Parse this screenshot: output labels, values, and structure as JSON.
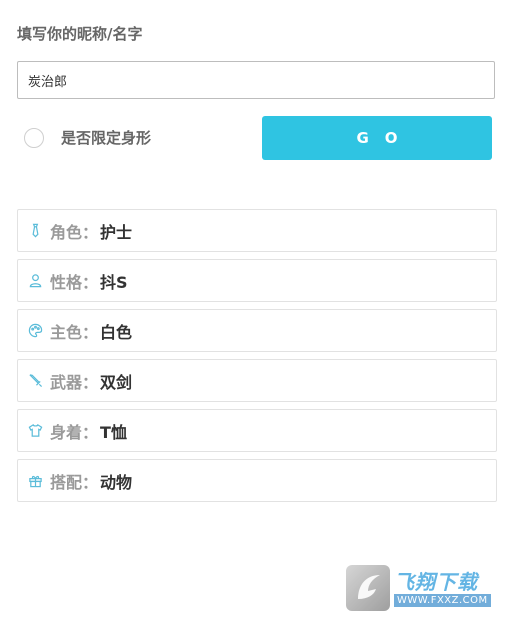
{
  "form": {
    "title": "填写你的昵称/名字",
    "name_value": "炭治郎",
    "toggle_label": "是否限定身形",
    "toggle_checked": false,
    "go_label": "GO",
    "accent_color": "#2fc4e2"
  },
  "attributes": [
    {
      "icon": "tie-icon",
      "label": "角色",
      "value": "护士"
    },
    {
      "icon": "person-icon",
      "label": "性格",
      "value": "抖S"
    },
    {
      "icon": "palette-icon",
      "label": "主色",
      "value": "白色"
    },
    {
      "icon": "sword-icon",
      "label": "武器",
      "value": "双剑"
    },
    {
      "icon": "shirt-icon",
      "label": "身着",
      "value": "T恤"
    },
    {
      "icon": "gift-icon",
      "label": "搭配",
      "value": "动物"
    }
  ],
  "colon": "：",
  "watermark": {
    "name": "飞翔下载",
    "url": "WWW.FXXZ.COM"
  }
}
